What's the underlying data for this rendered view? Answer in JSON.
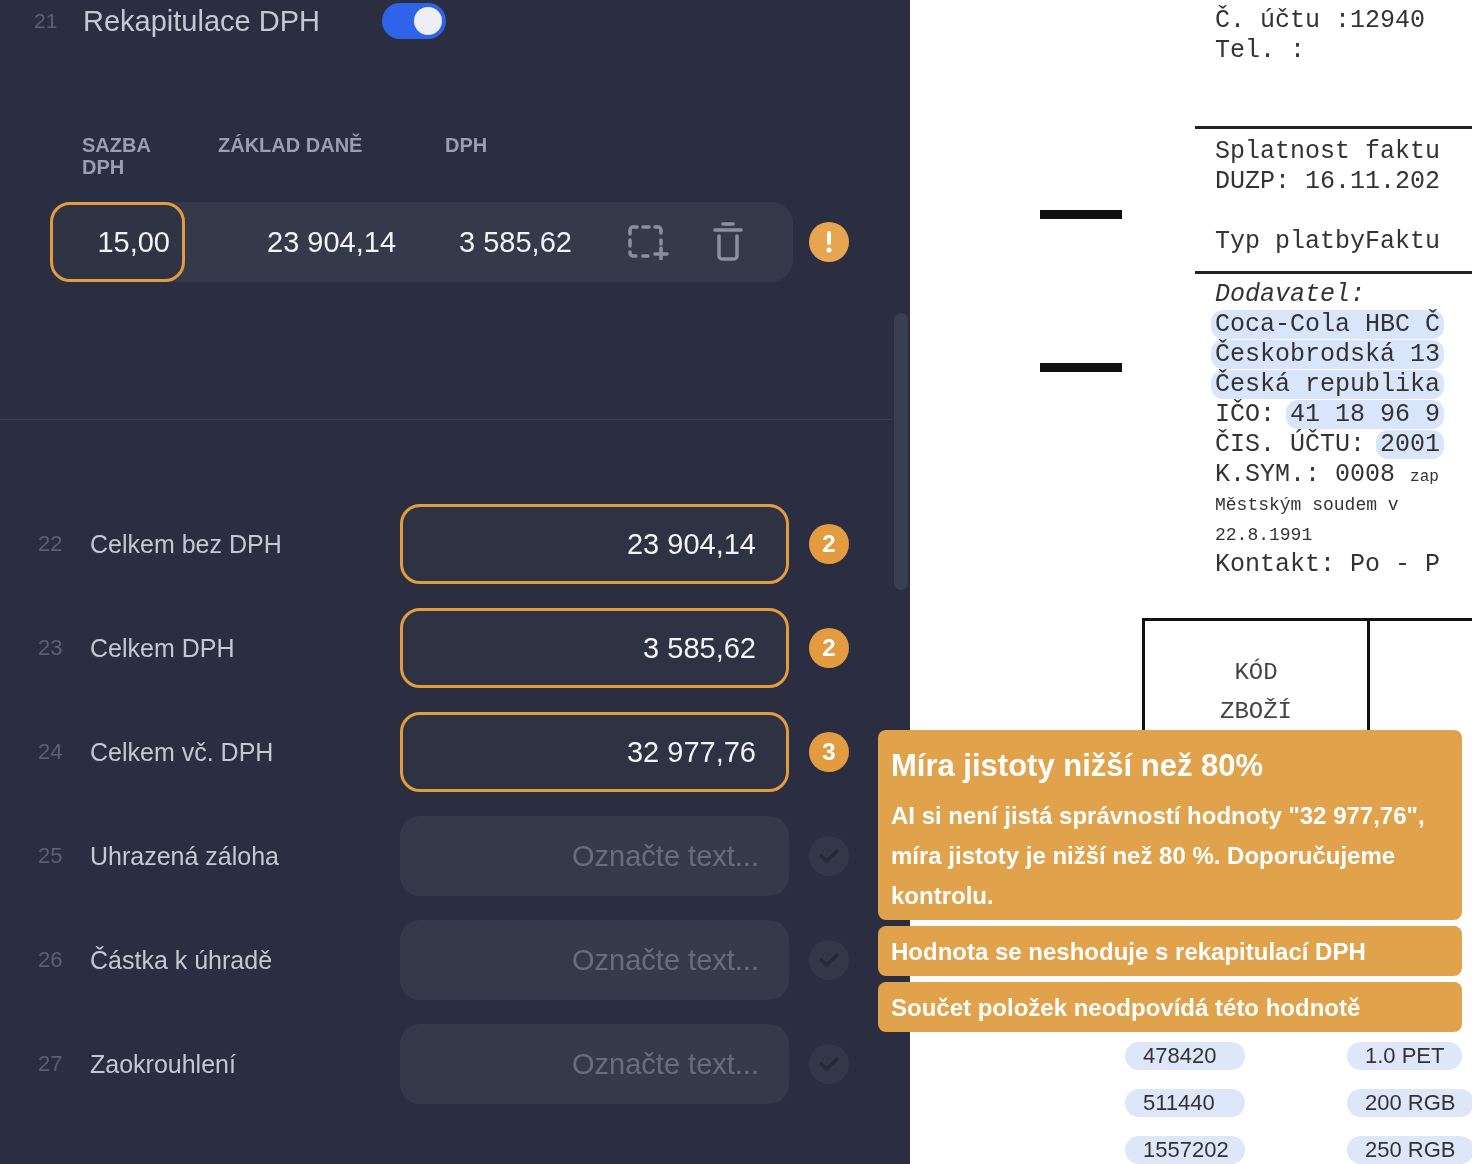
{
  "vat_recap": {
    "line": "21",
    "title": "Rekapitulace DPH",
    "enabled": true,
    "columns": [
      "SAZBA DPH",
      "ZÁKLAD DANĚ",
      "DPH"
    ],
    "rows": [
      {
        "rate": "15,00",
        "rate_warning": true,
        "base": "23 904,14",
        "vat": "3 585,62",
        "warning": true
      }
    ]
  },
  "fields": [
    {
      "line": "22",
      "label": "Celkem bez DPH",
      "value": "23 904,14",
      "warning": true,
      "kind": "badge",
      "badge": "2"
    },
    {
      "line": "23",
      "label": "Celkem DPH",
      "value": "3 585,62",
      "warning": true,
      "kind": "badge",
      "badge": "2"
    },
    {
      "line": "24",
      "label": "Celkem vč. DPH",
      "value": "32 977,76",
      "warning": true,
      "kind": "badge",
      "badge": "3"
    },
    {
      "line": "25",
      "label": "Uhrazená záloha",
      "placeholder": "Označte text...",
      "warning": false,
      "kind": "check"
    },
    {
      "line": "26",
      "label": "Částka k úhradě",
      "placeholder": "Označte text...",
      "warning": false,
      "kind": "check"
    },
    {
      "line": "27",
      "label": "Zaokrouhlení",
      "placeholder": "Označte text...",
      "warning": false,
      "kind": "check"
    }
  ],
  "tooltip": {
    "title": "Míra jistoty nižší než 80%",
    "body": "AI si není jistá správností hodnoty \"32 977,76\", míra jistoty je nižší než 80 %. Doporučujeme kontrolu.",
    "items": [
      "Hodnota se neshoduje s rekapitulací DPH",
      "Součet položek neodpovídá této hodnotě"
    ]
  },
  "document": {
    "lines": [
      {
        "kind": "plain",
        "text": "Č. účtu  :12940"
      },
      {
        "kind": "plain",
        "text": "Tel.  :"
      },
      {
        "kind": "rule"
      },
      {
        "kind": "plain",
        "text": "Splatnost faktu"
      },
      {
        "kind": "plain",
        "text": "DUZP: 16.11.202"
      },
      {
        "kind": "gap"
      },
      {
        "kind": "plain",
        "text": "Typ platbyFaktu"
      },
      {
        "kind": "rule"
      },
      {
        "kind": "italic",
        "text": "Dodavatel:"
      },
      {
        "kind": "highlight",
        "text": "Coca-Cola HBC Č"
      },
      {
        "kind": "highlight",
        "text": "Českobrodská 13"
      },
      {
        "kind": "highlight",
        "text": "Česká republika"
      },
      {
        "kind": "labeled",
        "label": "IČO:",
        "text": "41 18 96 9"
      },
      {
        "kind": "labeled",
        "label": "ČIS. ÚČTU:",
        "text": "2001"
      },
      {
        "kind": "suffixed",
        "text": "K.SYM.: 0008",
        "suffix": "zap"
      },
      {
        "kind": "small",
        "text": "Městským soudem v"
      },
      {
        "kind": "small",
        "text": "22.8.1991"
      },
      {
        "kind": "plain",
        "text": "Kontakt: Po - P"
      }
    ],
    "table": {
      "header_lines": [
        "KÓD",
        "ZBOŽÍ"
      ],
      "rows": [
        {
          "code": "478420",
          "unit": "1.0 PET"
        },
        {
          "code": "511440",
          "unit": "200 RGB"
        },
        {
          "code": "1557202",
          "unit": "250 RGB"
        }
      ]
    }
  }
}
